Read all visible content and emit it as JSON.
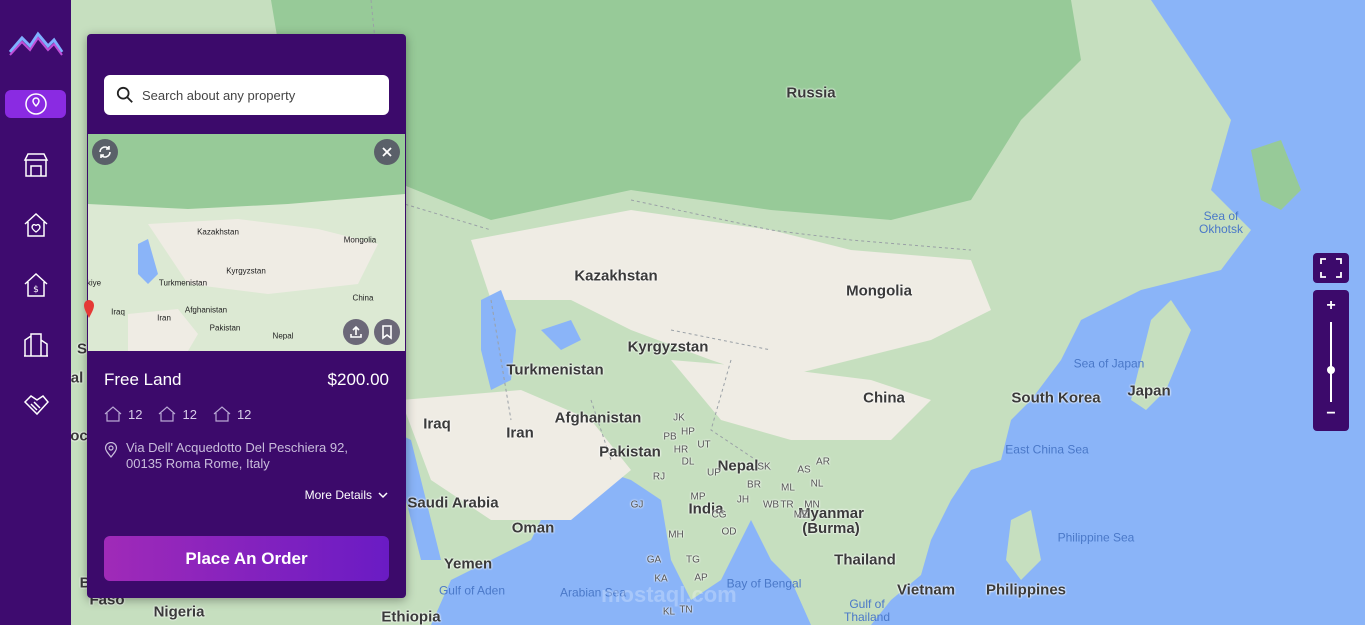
{
  "search": {
    "placeholder": "Search about any property"
  },
  "property": {
    "title": "Free Land",
    "price": "$200.00",
    "features": [
      {
        "icon": "house-icon",
        "value": "12"
      },
      {
        "icon": "house-icon",
        "value": "12"
      },
      {
        "icon": "house-icon",
        "value": "12"
      }
    ],
    "address": "Via Dell' Acquedotto Del Peschiera 92, 00135 Roma Rome, Italy",
    "more_label": "More Details",
    "order_label": "Place An Order"
  },
  "preview_labels": [
    "Kazakhstan",
    "Mongolia",
    "Kyrgyzstan",
    "Turkmenistan",
    "Afghanistan",
    "Iraq",
    "Iran",
    "Pakistan",
    "Nepal",
    "China",
    "kiye"
  ],
  "map_labels": {
    "countries": [
      "Russia",
      "Kazakhstan",
      "Mongolia",
      "Kyrgyzstan",
      "Turkmenistan",
      "Afghanistan",
      "China",
      "South Korea",
      "Japan",
      "Iraq",
      "Iran",
      "Pakistan",
      "Nepal",
      "India",
      "Myanmar (Burma)",
      "Thailand",
      "Vietnam",
      "Philippines",
      "Saudi Arabia",
      "Oman",
      "Yemen",
      "Nigeria",
      "Ethiopia"
    ],
    "seas": [
      "Sea of Okhotsk",
      "Sea of Japan",
      "East China Sea",
      "Philippine Sea",
      "Bay of Bengal",
      "Arabian Sea",
      "Gulf of Aden",
      "Gulf of Thailand"
    ],
    "small": [
      "JK",
      "HP",
      "PB",
      "UT",
      "HR",
      "DL",
      "RJ",
      "UP",
      "BR",
      "ML",
      "NL",
      "GJ",
      "MP",
      "MH",
      "TG",
      "OD",
      "AP",
      "KA",
      "TN",
      "KL",
      "CG",
      "JH",
      "WB",
      "AS",
      "MN",
      "MZ",
      "TR",
      "SK",
      "AR",
      "GA",
      "Faso",
      "al",
      "oc",
      "S",
      "B"
    ]
  },
  "map_controls": {
    "zoom_in": "+",
    "zoom_out": "−",
    "zoom_level": 0.4
  },
  "colors": {
    "sidebar": "#3e0b6f",
    "panel": "#3c0a6b",
    "accent": "#8a2be2",
    "water": "#8ab4f8",
    "land": "#c6dfbf"
  },
  "watermark": "mostaql.com"
}
